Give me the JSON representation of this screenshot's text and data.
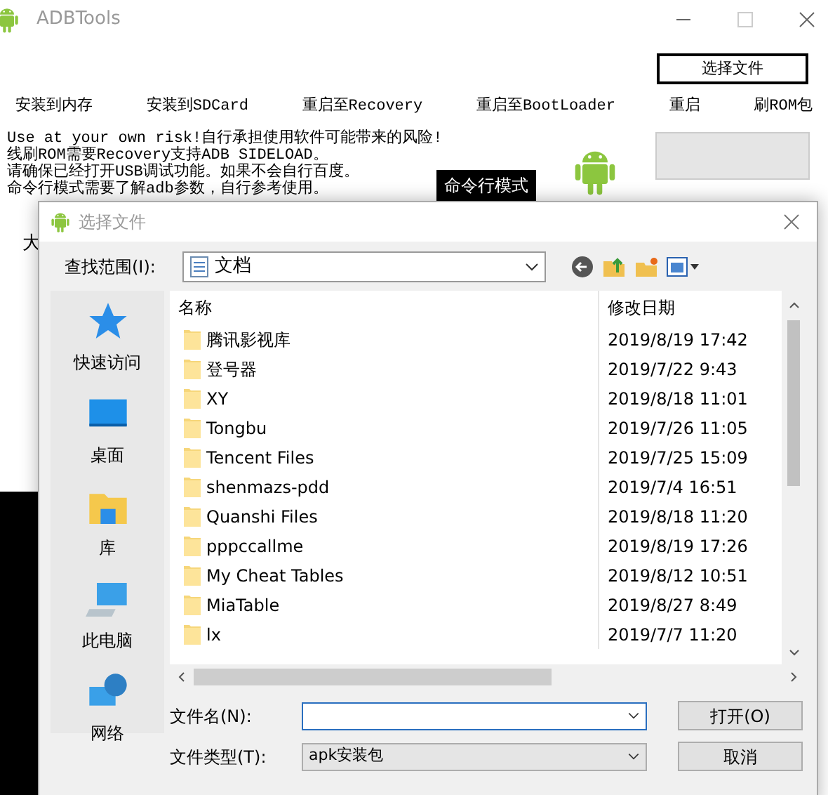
{
  "window": {
    "title": "ADBTools"
  },
  "select_file_button": "选择文件",
  "actions": [
    "安装到内存",
    "安装到SDCard",
    "重启至Recovery",
    "重启至BootLoader",
    "重启",
    "刷ROM包"
  ],
  "notice_lines": [
    "Use at your own risk!自行承担使用软件可能带来的风险!",
    "线刷ROM需要Recovery支持ADB SIDELOAD。",
    "请确保已经打开USB调试功能。如果不会自行百度。",
    "命令行模式需要了解adb参数，自行参考使用。"
  ],
  "command_mode_button": "命令行模式",
  "background_text": "大",
  "dialog": {
    "title": "选择文件",
    "look_in": {
      "label": "查找范围(I):",
      "value": "文档"
    },
    "places": [
      {
        "label": "快速访问",
        "kind": "star"
      },
      {
        "label": "桌面",
        "kind": "desktop"
      },
      {
        "label": "库",
        "kind": "library"
      },
      {
        "label": "此电脑",
        "kind": "computer"
      },
      {
        "label": "网络",
        "kind": "network"
      }
    ],
    "columns": [
      "名称",
      "修改日期"
    ],
    "rows": [
      {
        "name": "腾讯影视库",
        "date": "2019/8/19 17:42"
      },
      {
        "name": "登号器",
        "date": "2019/7/22 9:43"
      },
      {
        "name": "XY",
        "date": "2019/8/18 11:01"
      },
      {
        "name": "Tongbu",
        "date": "2019/7/26 11:05"
      },
      {
        "name": "Tencent Files",
        "date": "2019/7/25 15:09"
      },
      {
        "name": "shenmazs-pdd",
        "date": "2019/7/4 16:51"
      },
      {
        "name": "Quanshi Files",
        "date": "2019/8/18 11:20"
      },
      {
        "name": "pppccallme",
        "date": "2019/8/19 17:26"
      },
      {
        "name": "My Cheat Tables",
        "date": "2019/8/12 10:51"
      },
      {
        "name": "MiaTable",
        "date": "2019/8/27 8:49"
      },
      {
        "name": "lx",
        "date": "2019/7/7 11:20"
      }
    ],
    "file_name": {
      "label": "文件名(N):"
    },
    "file_type": {
      "label": "文件类型(T):",
      "value": "apk安装包"
    },
    "buttons": [
      "打开(O)",
      "取消"
    ]
  }
}
